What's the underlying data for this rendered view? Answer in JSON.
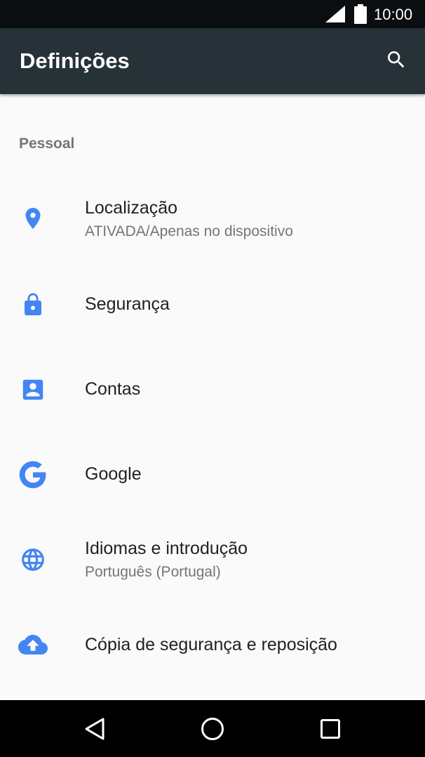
{
  "status_bar": {
    "time": "10:00",
    "icons": [
      "signal-icon",
      "battery-icon"
    ]
  },
  "app_bar": {
    "title": "Definições",
    "search_icon": "search-icon"
  },
  "section": {
    "header": "Pessoal"
  },
  "items": [
    {
      "label": "Localização",
      "summary": "ATIVADA/Apenas no dispositivo",
      "icon": "location-pin-icon"
    },
    {
      "label": "Segurança",
      "summary": "",
      "icon": "lock-icon"
    },
    {
      "label": "Contas",
      "summary": "",
      "icon": "account-box-icon"
    },
    {
      "label": "Google",
      "summary": "",
      "icon": "google-icon"
    },
    {
      "label": "Idiomas e introdução",
      "summary": "Português (Portugal)",
      "icon": "globe-icon"
    },
    {
      "label": "Cópia de segurança e reposição",
      "summary": "",
      "icon": "cloud-upload-icon"
    }
  ],
  "nav_bar": {
    "buttons": [
      "back-icon",
      "home-icon",
      "recents-icon"
    ]
  },
  "colors": {
    "accent": "#4285f4",
    "app_bar": "#263238",
    "status_bar": "#0b0e11",
    "background": "#fafafa"
  }
}
